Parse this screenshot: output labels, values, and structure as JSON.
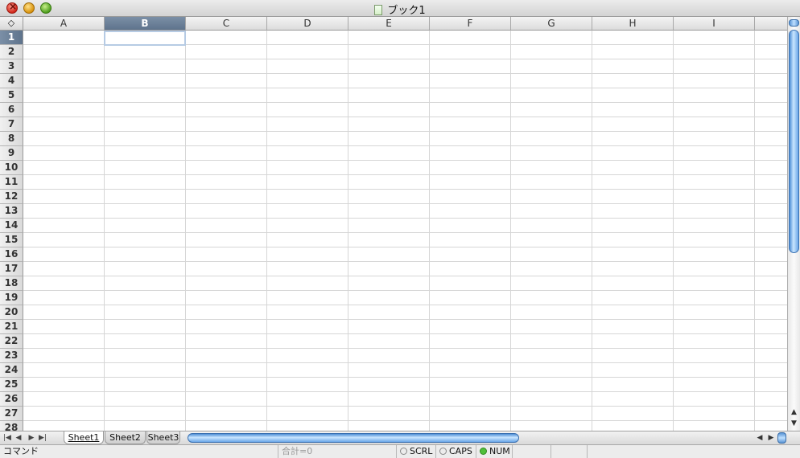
{
  "window": {
    "title": "ブック1"
  },
  "grid": {
    "corner_icon": "diamond-icon",
    "columns": [
      "A",
      "B",
      "C",
      "D",
      "E",
      "F",
      "G",
      "H",
      "I"
    ],
    "rows": [
      "1",
      "2",
      "3",
      "4",
      "5",
      "6",
      "7",
      "8",
      "9",
      "10",
      "11",
      "12",
      "13",
      "14",
      "15",
      "16",
      "17",
      "18",
      "19",
      "20",
      "21",
      "22",
      "23",
      "24",
      "25",
      "26",
      "27",
      "28"
    ],
    "selected_column": "B",
    "selected_row": "1"
  },
  "sheets": {
    "tabs": [
      "Sheet1",
      "Sheet2",
      "Sheet3"
    ],
    "active": "Sheet1",
    "nav_icons": [
      "first-sheet-icon",
      "prev-sheet-icon",
      "next-sheet-icon",
      "last-sheet-icon"
    ]
  },
  "status": {
    "mode": "コマンド",
    "sum": "合計=0",
    "scrl": "SCRL",
    "caps": "CAPS",
    "num": "NUM"
  },
  "colors": {
    "selection_header": "#6a7f97",
    "scroll_thumb": "#4e8ed6",
    "num_indicator": "#4fbf3a"
  }
}
